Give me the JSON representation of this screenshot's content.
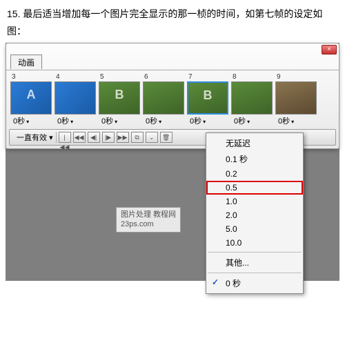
{
  "instruction": "15. 最后适当增加每一个图片完全显示的那一桢的时间，如第七帧的设定如图：",
  "panel": {
    "tab": "动画",
    "close": "×",
    "loop": "一直有效",
    "loop_arrow": "▾",
    "btns": [
      "|◀◀",
      "◀◀",
      "◀|",
      "|▶",
      "▶▶",
      "⧉",
      "⌄",
      "🗑"
    ]
  },
  "frames": [
    {
      "n": "3",
      "cl": "blue",
      "l": "A",
      "t": "0秒"
    },
    {
      "n": "4",
      "cl": "blue",
      "l": "",
      "t": "0秒"
    },
    {
      "n": "5",
      "cl": "green",
      "l": "B",
      "t": "0秒"
    },
    {
      "n": "6",
      "cl": "green",
      "l": "",
      "t": "0秒"
    },
    {
      "n": "7",
      "cl": "green",
      "l": "B",
      "t": "0秒",
      "sel": true
    },
    {
      "n": "8",
      "cl": "green",
      "l": "",
      "t": "0秒"
    },
    {
      "n": "9",
      "cl": "brown",
      "l": "",
      "t": "0秒"
    }
  ],
  "menu": {
    "items": [
      {
        "label": "无延迟"
      },
      {
        "label": "0.1 秒"
      },
      {
        "label": "0.2"
      },
      {
        "label": "0.5",
        "hi": true
      },
      {
        "label": "1.0"
      },
      {
        "label": "2.0"
      },
      {
        "label": "5.0"
      },
      {
        "label": "10.0"
      },
      {
        "sep": true
      },
      {
        "label": "其他..."
      },
      {
        "sep": true
      },
      {
        "label": "0 秒",
        "check": "✓"
      }
    ]
  },
  "wm": {
    "l1": "图片处理 教程网",
    "l2": "23ps.com"
  }
}
